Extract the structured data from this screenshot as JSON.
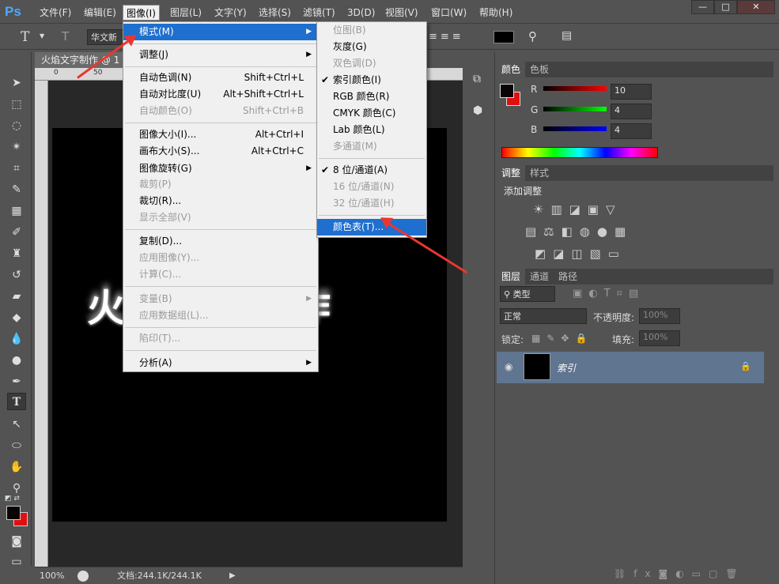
{
  "app_logo": "Ps",
  "menubar": [
    "文件(F)",
    "编辑(E)",
    "图像(I)",
    "图层(L)",
    "文字(Y)",
    "选择(S)",
    "滤镜(T)",
    "3D(D)",
    "视图(V)",
    "窗口(W)",
    "帮助(H)"
  ],
  "window_controls": [
    "—",
    "□",
    "✕"
  ],
  "options": {
    "font_name": "华文新"
  },
  "document": {
    "tab": "火焰文字制作 @ 1",
    "zoom": "100%",
    "docinfo": "文档:244.1K/244.1K",
    "ruler_marks": [
      "0",
      "50"
    ],
    "text": "火焰文字制作"
  },
  "image_menu": [
    {
      "label": "模式(M)",
      "submenu": true,
      "highlighted": true
    },
    {
      "label": "调整(J)",
      "submenu": true
    },
    {
      "label": "自动色调(N)",
      "shortcut": "Shift+Ctrl+L"
    },
    {
      "label": "自动对比度(U)",
      "shortcut": "Alt+Shift+Ctrl+L"
    },
    {
      "label": "自动颜色(O)",
      "shortcut": "Shift+Ctrl+B",
      "disabled": true
    },
    {
      "label": "图像大小(I)...",
      "shortcut": "Alt+Ctrl+I"
    },
    {
      "label": "画布大小(S)...",
      "shortcut": "Alt+Ctrl+C"
    },
    {
      "label": "图像旋转(G)",
      "submenu": true
    },
    {
      "label": "裁剪(P)",
      "disabled": true
    },
    {
      "label": "裁切(R)..."
    },
    {
      "label": "显示全部(V)",
      "disabled": true
    },
    {
      "label": "复制(D)..."
    },
    {
      "label": "应用图像(Y)...",
      "disabled": true
    },
    {
      "label": "计算(C)...",
      "disabled": true
    },
    {
      "label": "变量(B)",
      "submenu": true,
      "disabled": true
    },
    {
      "label": "应用数据组(L)...",
      "disabled": true
    },
    {
      "label": "陷印(T)...",
      "disabled": true
    },
    {
      "label": "分析(A)",
      "submenu": true
    }
  ],
  "mode_menu": [
    {
      "label": "位图(B)",
      "disabled": true
    },
    {
      "label": "灰度(G)"
    },
    {
      "label": "双色调(D)",
      "disabled": true
    },
    {
      "label": "索引颜色(I)",
      "checked": true
    },
    {
      "label": "RGB 颜色(R)"
    },
    {
      "label": "CMYK 颜色(C)"
    },
    {
      "label": "Lab 颜色(L)"
    },
    {
      "label": "多通道(M)",
      "disabled": true
    },
    {
      "label": "8 位/通道(A)",
      "checked": true
    },
    {
      "label": "16 位/通道(N)",
      "disabled": true
    },
    {
      "label": "32 位/通道(H)",
      "disabled": true
    },
    {
      "label": "颜色表(T)...",
      "highlighted": true
    }
  ],
  "color_panel": {
    "tabs": [
      "颜色",
      "色板"
    ],
    "r_label": "R",
    "g_label": "G",
    "b_label": "B",
    "r": "10",
    "g": "4",
    "b": "4",
    "fg_color": "#0a0404",
    "bg_color": "#e01010"
  },
  "adjust_panel": {
    "tabs": [
      "调整",
      "样式"
    ],
    "title": "添加调整"
  },
  "layers_panel": {
    "tabs": [
      "图层",
      "通道",
      "路径"
    ],
    "kind": "类型",
    "blend": "正常",
    "opacity_label": "不透明度:",
    "opacity": "100%",
    "lock_label": "锁定:",
    "fill_label": "填充:",
    "fill": "100%",
    "layer_name": "索引"
  }
}
